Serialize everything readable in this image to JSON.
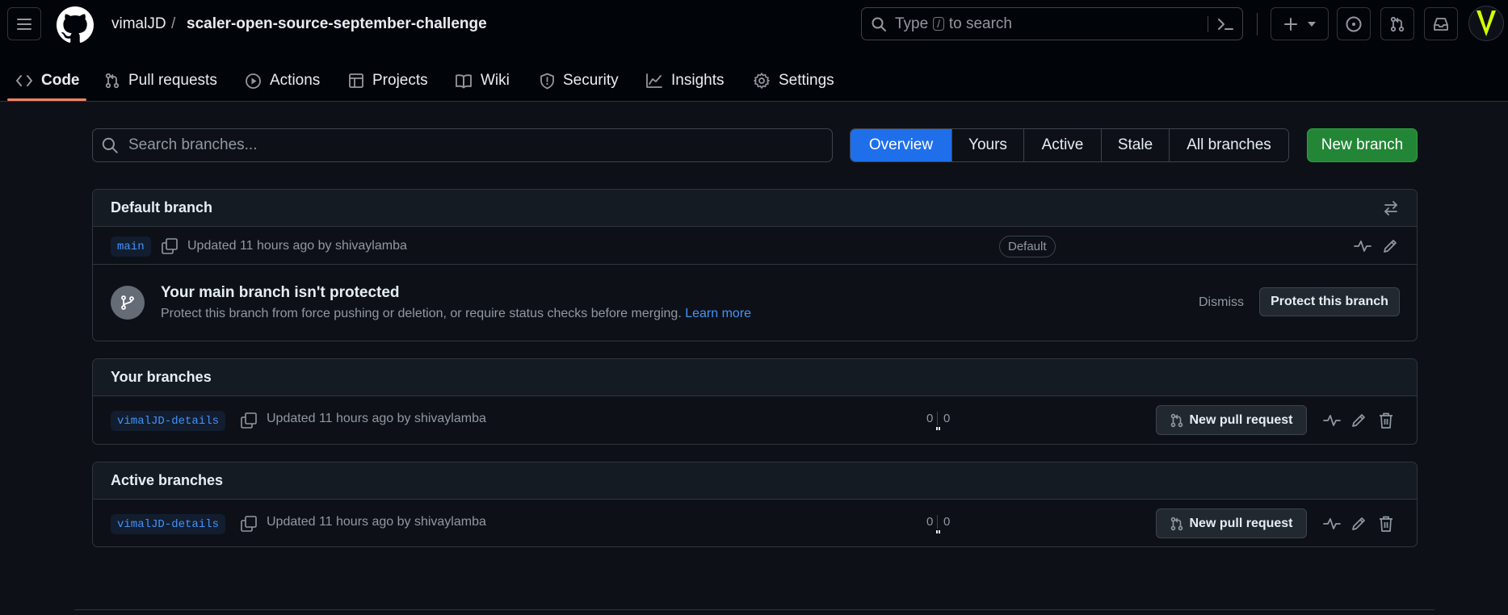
{
  "repo": {
    "owner": "vimalJD",
    "separator": "/",
    "name": "scaler-open-source-september-challenge"
  },
  "search": {
    "pre": "Type",
    "key": "/",
    "post": "to search"
  },
  "tabs": [
    {
      "label": "Code",
      "icon": "code-icon",
      "active": true
    },
    {
      "label": "Pull requests",
      "icon": "git-pull-request-icon"
    },
    {
      "label": "Actions",
      "icon": "play-icon"
    },
    {
      "label": "Projects",
      "icon": "table-icon"
    },
    {
      "label": "Wiki",
      "icon": "book-icon"
    },
    {
      "label": "Security",
      "icon": "shield-icon"
    },
    {
      "label": "Insights",
      "icon": "graph-icon"
    },
    {
      "label": "Settings",
      "icon": "gear-icon"
    }
  ],
  "branch_search": {
    "placeholder": "Search branches..."
  },
  "filters": [
    "Overview",
    "Yours",
    "Active",
    "Stale",
    "All branches"
  ],
  "new_branch_label": "New branch",
  "default_section": {
    "title": "Default branch",
    "branch": "main",
    "updated": "Updated 11 hours ago by shivaylamba",
    "badge": "Default"
  },
  "protect": {
    "title": "Your main branch isn't protected",
    "description": "Protect this branch from force pushing or deletion, or require status checks before merging.",
    "link": "Learn more",
    "dismiss": "Dismiss",
    "button": "Protect this branch"
  },
  "your_section": {
    "title": "Your branches",
    "branch": "vimalJD-details",
    "updated": "Updated 11 hours ago by shivaylamba",
    "behind": "0",
    "ahead": "0",
    "pr_label": "New pull request"
  },
  "active_section": {
    "title": "Active branches",
    "branch": "vimalJD-details",
    "updated": "Updated 11 hours ago by shivaylamba",
    "behind": "0",
    "ahead": "0",
    "pr_label": "New pull request"
  },
  "colors": {
    "background": "#0d1117",
    "header": "#010409",
    "accent_blue": "#1f6feb",
    "primary_green": "#238636",
    "link": "#4493f8",
    "tab_underline": "#f78166",
    "avatar": "#d4ff00"
  }
}
